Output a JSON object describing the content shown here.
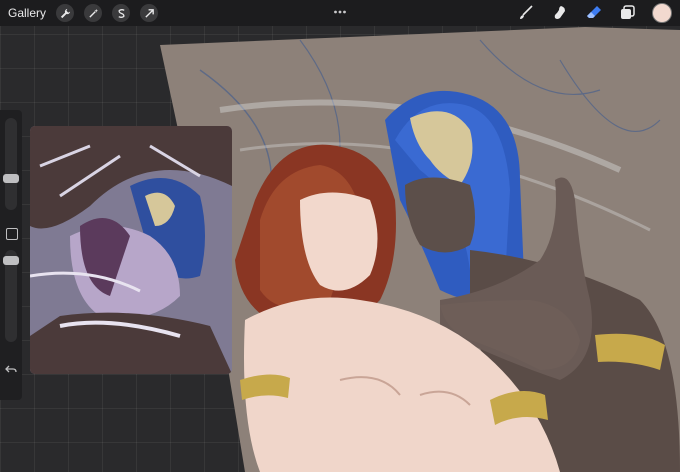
{
  "app": {
    "gallery_label": "Gallery",
    "toolbar_left_icons": [
      "wrench-icon",
      "magic-wand-icon",
      "selection-s-icon",
      "transform-arrow-icon"
    ],
    "more_icon": "more-dots-icon",
    "toolbar_right_icons": [
      "brush-icon",
      "smudge-icon",
      "eraser-icon",
      "layers-icon"
    ],
    "active_tool": "eraser-icon",
    "current_color": "#f2d9cf",
    "accent_color": "#3d7cf2"
  },
  "sidebar": {
    "icons": [
      "brush-size-slider",
      "modify-button",
      "opacity-slider",
      "undo-icon"
    ]
  }
}
